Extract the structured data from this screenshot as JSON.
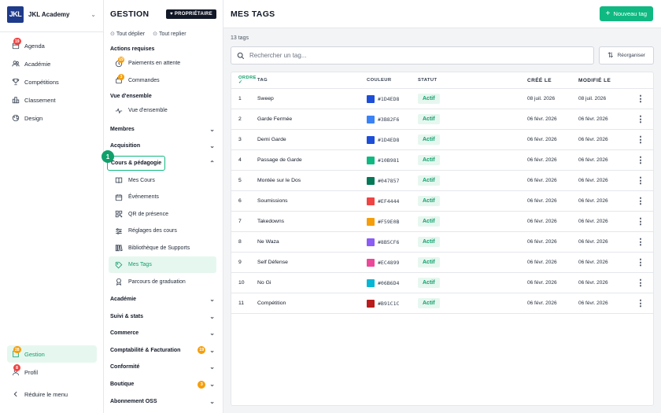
{
  "rail": {
    "brand_logo": "JKL",
    "brand_name": "JKL Academy",
    "items": [
      {
        "label": "Agenda",
        "badge": "19"
      },
      {
        "label": "Académie"
      },
      {
        "label": "Compétitions"
      },
      {
        "label": "Classement"
      },
      {
        "label": "Design"
      }
    ],
    "bottom": [
      {
        "label": "Gestion",
        "badge": "28"
      },
      {
        "label": "Profil",
        "badge": "8"
      }
    ],
    "collapse_label": "Réduire le menu"
  },
  "panel": {
    "title": "GESTION",
    "owner_badge": "PROPRIÉTAIRE",
    "expand_all": "Tout déplier",
    "collapse_all": "Tout replier",
    "actions_label": "Actions requises",
    "actions": [
      {
        "label": "Paiements en attente",
        "badge": "19"
      },
      {
        "label": "Commandes",
        "badge": "3"
      }
    ],
    "overview_label": "Vue d'ensemble",
    "overview_item": "Vue d'ensemble",
    "groups_top": [
      "Membres",
      "Acquisition"
    ],
    "courses_group": "Cours & pédagogie",
    "callout": "1",
    "courses_items": [
      "Mes Cours",
      "Événements",
      "QR de présence",
      "Réglages des cours",
      "Bibliothèque de Supports",
      "Mes Tags",
      "Parcours de graduation"
    ],
    "groups_bottom": [
      {
        "label": "Académie"
      },
      {
        "label": "Suivi & stats"
      },
      {
        "label": "Commerce"
      },
      {
        "label": "Comptabilité & Facturation",
        "count": "19"
      },
      {
        "label": "Conformité"
      },
      {
        "label": "Boutique",
        "count": "3"
      },
      {
        "label": "Abonnement OSS"
      }
    ]
  },
  "main": {
    "title": "MES TAGS",
    "new_button": "Nouveau tag",
    "count_text": "13 tags",
    "search_placeholder": "Rechercher un tag...",
    "reorder_button": "Réorganiser",
    "columns": {
      "order": "ORDRE",
      "tag": "TAG",
      "color": "COULEUR",
      "status": "STATUT",
      "created": "CRÉÉ LE",
      "modified": "MODIFIÉ LE"
    },
    "rows": [
      {
        "order": "1",
        "tag": "Sweep",
        "color": "#1D4ED8",
        "status": "Actif",
        "created": "08 juil. 2026",
        "modified": "08 juil. 2026"
      },
      {
        "order": "2",
        "tag": "Garde Fermée",
        "color": "#3B82F6",
        "status": "Actif",
        "created": "06 févr. 2026",
        "modified": "06 févr. 2026"
      },
      {
        "order": "3",
        "tag": "Demi Garde",
        "color": "#1D4ED8",
        "status": "Actif",
        "created": "06 févr. 2026",
        "modified": "06 févr. 2026"
      },
      {
        "order": "4",
        "tag": "Passage de Garde",
        "color": "#10B981",
        "status": "Actif",
        "created": "06 févr. 2026",
        "modified": "06 févr. 2026"
      },
      {
        "order": "5",
        "tag": "Montée sur le Dos",
        "color": "#047857",
        "status": "Actif",
        "created": "06 févr. 2026",
        "modified": "06 févr. 2026"
      },
      {
        "order": "6",
        "tag": "Soumissions",
        "color": "#EF4444",
        "status": "Actif",
        "created": "06 févr. 2026",
        "modified": "06 févr. 2026"
      },
      {
        "order": "7",
        "tag": "Takedowns",
        "color": "#F59E0B",
        "status": "Actif",
        "created": "06 févr. 2026",
        "modified": "06 févr. 2026"
      },
      {
        "order": "8",
        "tag": "Ne Waza",
        "color": "#8B5CF6",
        "status": "Actif",
        "created": "06 févr. 2026",
        "modified": "06 févr. 2026"
      },
      {
        "order": "9",
        "tag": "Self Défense",
        "color": "#EC4899",
        "status": "Actif",
        "created": "06 févr. 2026",
        "modified": "06 févr. 2026"
      },
      {
        "order": "10",
        "tag": "No Gi",
        "color": "#06B6D4",
        "status": "Actif",
        "created": "06 févr. 2026",
        "modified": "06 févr. 2026"
      },
      {
        "order": "11",
        "tag": "Compétition",
        "color": "#B91C1C",
        "status": "Actif",
        "created": "06 févr. 2026",
        "modified": "06 févr. 2026"
      }
    ]
  },
  "colors": {
    "accent": "#10B981",
    "accent_dark": "#10A06C",
    "badge_red": "#EF4444",
    "badge_orange": "#F59E0B"
  }
}
